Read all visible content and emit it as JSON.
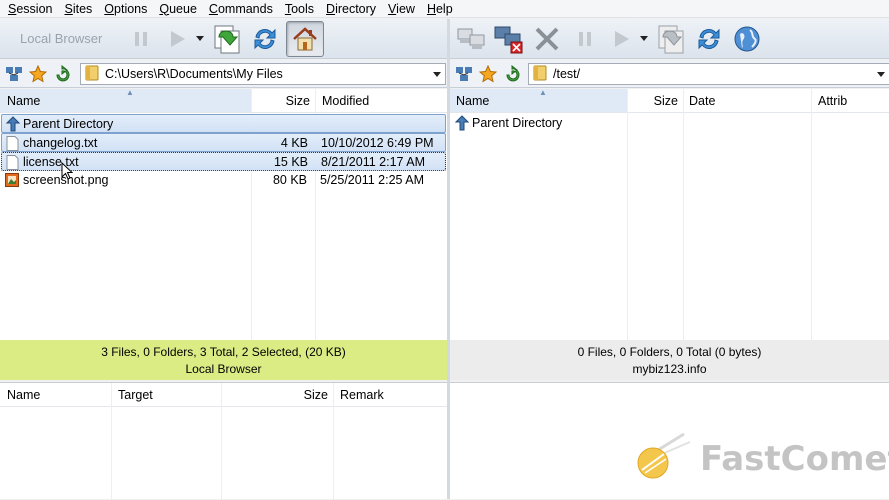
{
  "menu": [
    "Session",
    "Sites",
    "Options",
    "Queue",
    "Commands",
    "Tools",
    "Directory",
    "View",
    "Help"
  ],
  "menu_underline": [
    "S",
    "S",
    "O",
    "Q",
    "C",
    "T",
    "D",
    "V",
    "H"
  ],
  "toolbar": {
    "local_browser_label": "Local Browser"
  },
  "local": {
    "path": "C:\\Users\\R\\Documents\\My Files",
    "columns": [
      "Name",
      "Size",
      "Modified"
    ],
    "files": [
      {
        "name": "Parent Directory",
        "size": "",
        "modified": ""
      },
      {
        "name": "changelog.txt",
        "size": "4 KB",
        "modified": "10/10/2012 6:49 PM"
      },
      {
        "name": "license.txt",
        "size": "15 KB",
        "modified": "8/21/2011 2:17 AM"
      },
      {
        "name": "screenshot.png",
        "size": "80 KB",
        "modified": "5/25/2011 2:25 AM"
      }
    ],
    "status_line1": "3 Files, 0 Folders, 3 Total, 2 Selected, (20 KB)",
    "status_line2": "Local Browser"
  },
  "remote": {
    "path": "/test/",
    "columns": [
      "Name",
      "Size",
      "Date",
      "Attrib"
    ],
    "files": [
      {
        "name": "Parent Directory"
      }
    ],
    "status_line1": "0 Files, 0 Folders, 0 Total (0 bytes)",
    "status_line2": "mybiz123.info"
  },
  "queue": {
    "columns": [
      "Name",
      "Target",
      "Size",
      "Remark"
    ]
  },
  "watermark": "FastComet",
  "colors": {
    "status_local": "#dcec84",
    "selection": "#d1e1f5"
  }
}
